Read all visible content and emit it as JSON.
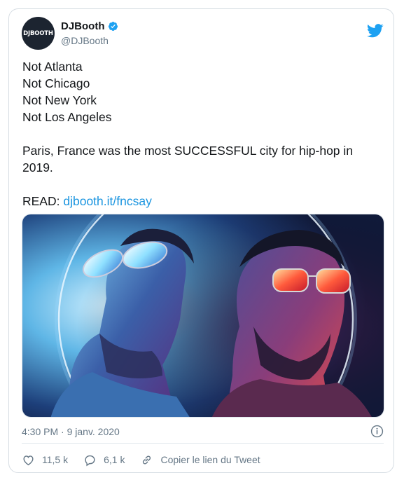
{
  "account": {
    "display_name": "DJBooth",
    "handle": "@DJBooth",
    "avatar_text": "DJBOOTH",
    "verified": true
  },
  "tweet": {
    "lines": [
      "Not Atlanta",
      "Not Chicago",
      "Not New York",
      "Not Los Angeles",
      "",
      "Paris, France was the most SUCCESSFUL city for hip-hop in 2019.",
      "",
      "READ: "
    ],
    "link_text": "djbooth.it/fncsay"
  },
  "timestamp": "4:30 PM · 9 janv. 2020",
  "actions": {
    "likes": "11,5 k",
    "replies": "6,1 k",
    "copy_link": "Copier le lien du Tweet"
  },
  "colors": {
    "accent": "#1da1f2",
    "link": "#1b95e0",
    "muted": "#657786",
    "border": "#d6dde3"
  },
  "icons": [
    "verified-badge-icon",
    "twitter-bird-icon",
    "info-icon",
    "heart-icon",
    "reply-icon",
    "link-icon"
  ]
}
